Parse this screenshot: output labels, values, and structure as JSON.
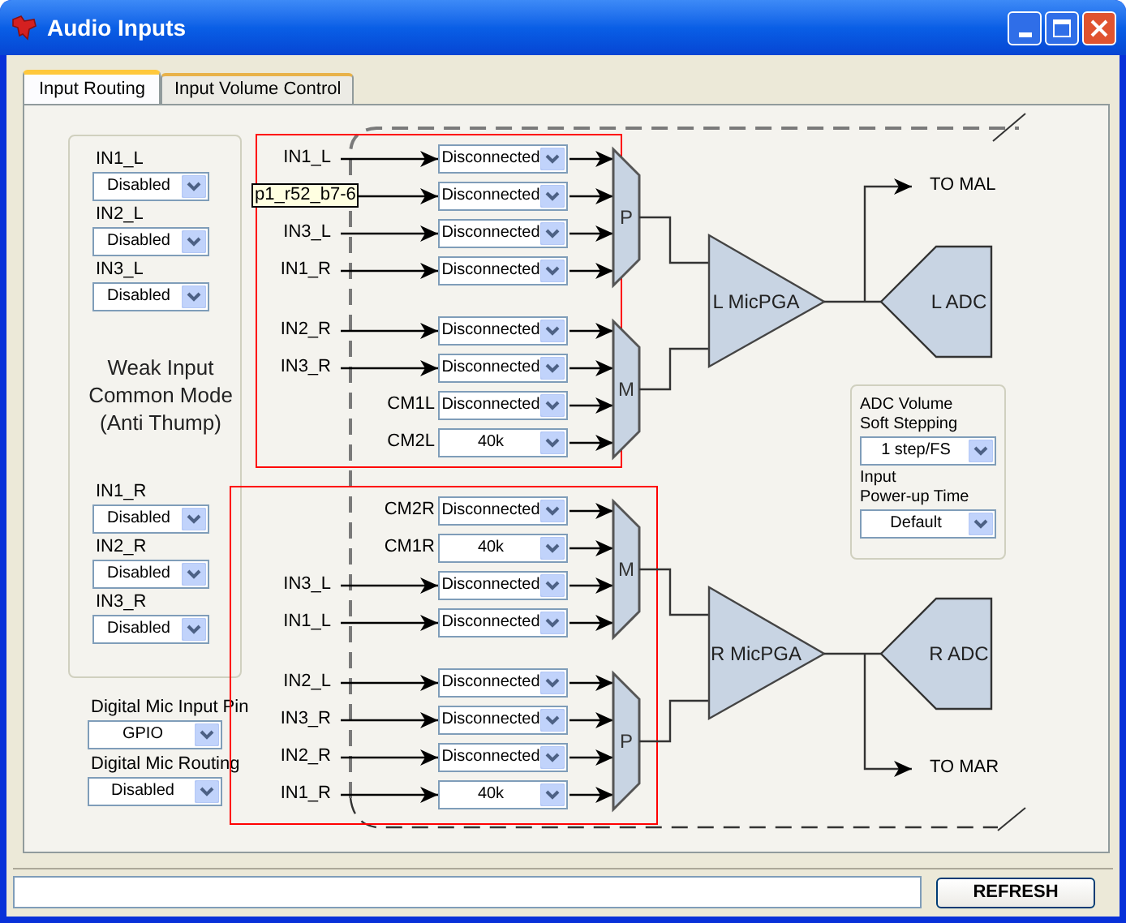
{
  "window": {
    "title": "Audio Inputs"
  },
  "tabs": [
    {
      "label": "Input Routing",
      "selected": true
    },
    {
      "label": "Input Volume Control",
      "selected": false
    }
  ],
  "weak_input_common_mode": {
    "left_inputs": [
      {
        "label": "IN1_L",
        "value": "Disabled"
      },
      {
        "label": "IN2_L",
        "value": "Disabled"
      },
      {
        "label": "IN3_L",
        "value": "Disabled"
      }
    ],
    "caption": "Weak Input\nCommon Mode\n(Anti Thump)",
    "right_inputs": [
      {
        "label": "IN1_R",
        "value": "Disabled"
      },
      {
        "label": "IN2_R",
        "value": "Disabled"
      },
      {
        "label": "IN3_R",
        "value": "Disabled"
      }
    ]
  },
  "digital_mic": [
    {
      "label": "Digital Mic Input Pin",
      "value": "GPIO"
    },
    {
      "label": "Digital Mic Routing",
      "value": "Disabled"
    }
  ],
  "routing": [
    {
      "highlighted": true,
      "pga": "L MicPGA",
      "adc": "L ADC",
      "output": "TO MAL",
      "mixers": [
        {
          "label": "P",
          "rows": [
            {
              "kind": "input",
              "source": "IN1_L",
              "value": "Disconnected"
            },
            {
              "kind": "input",
              "value": "Disconnected"
            },
            {
              "kind": "input",
              "source": "IN3_L",
              "value": "Disconnected"
            },
            {
              "kind": "input",
              "source": "IN1_R",
              "value": "Disconnected"
            }
          ]
        },
        {
          "label": "M",
          "rows": [
            {
              "kind": "input",
              "source": "IN2_R",
              "value": "Disconnected"
            },
            {
              "kind": "input",
              "source": "IN3_R",
              "value": "Disconnected"
            },
            {
              "kind": "common_mode",
              "source": "CM1L",
              "value": "Disconnected"
            },
            {
              "kind": "common_mode",
              "source": "CM2L",
              "value": "40k"
            }
          ]
        }
      ]
    },
    {
      "highlighted": true,
      "pga": "R MicPGA",
      "adc": "R ADC",
      "output": "TO MAR",
      "mixers": [
        {
          "label": "M",
          "rows": [
            {
              "kind": "common_mode",
              "source": "CM2R",
              "value": "Disconnected"
            },
            {
              "kind": "common_mode",
              "source": "CM1R",
              "value": "40k"
            },
            {
              "kind": "input",
              "source": "IN3_L",
              "value": "Disconnected"
            },
            {
              "kind": "input",
              "source": "IN1_L",
              "value": "Disconnected"
            }
          ]
        },
        {
          "label": "P",
          "rows": [
            {
              "kind": "input",
              "source": "IN2_L",
              "value": "Disconnected"
            },
            {
              "kind": "input",
              "source": "IN3_R",
              "value": "Disconnected"
            },
            {
              "kind": "input",
              "source": "IN2_R",
              "value": "Disconnected"
            },
            {
              "kind": "input",
              "source": "IN1_R",
              "value": "40k"
            }
          ]
        }
      ]
    }
  ],
  "tooltip": "p1_r52_b7-6",
  "adc_settings": [
    {
      "label": "ADC Volume\nSoft Stepping",
      "value": "1 step/FS"
    },
    {
      "label": "Input\nPower-up Time",
      "value": "Default"
    }
  ],
  "buttons": [
    {
      "label": "REFRESH"
    }
  ]
}
